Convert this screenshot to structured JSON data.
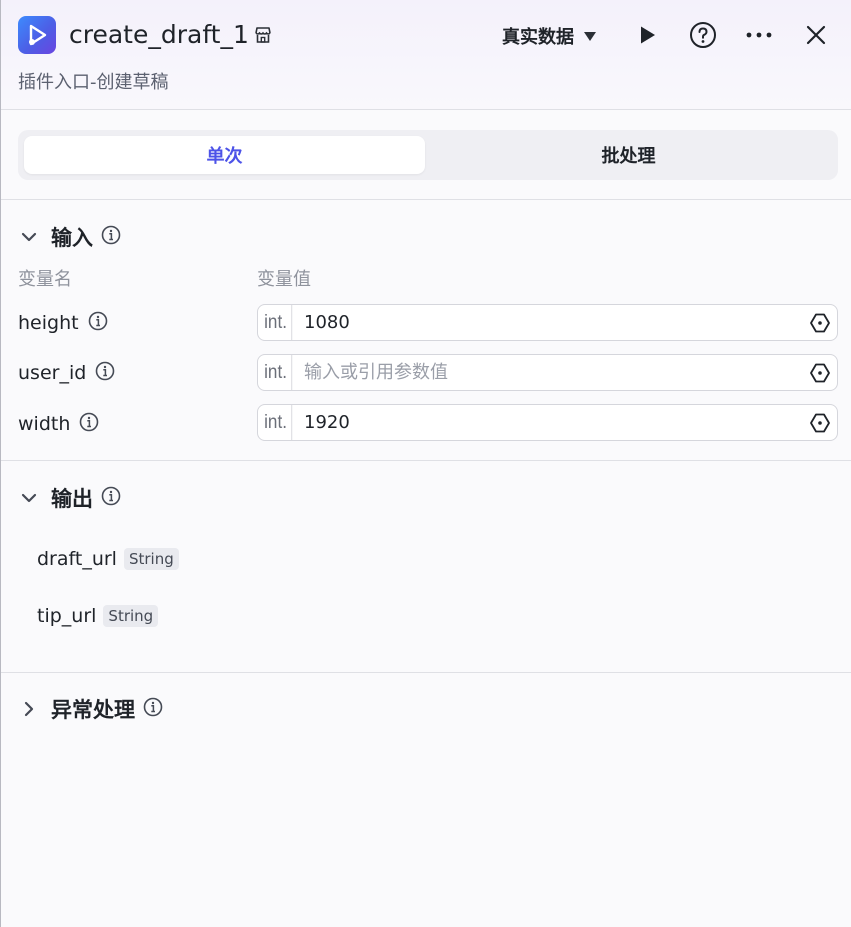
{
  "header": {
    "title": "create_draft_1",
    "subtitle": "插件入口-创建草稿",
    "mode_label": "真实数据",
    "icons": [
      "app-play-icon",
      "store-icon",
      "caret-down-icon",
      "run-icon",
      "help-icon",
      "more-icon",
      "close-icon"
    ]
  },
  "tabs": [
    {
      "label": "单次",
      "active": true
    },
    {
      "label": "批处理",
      "active": false
    }
  ],
  "input_section": {
    "title": "输入",
    "col_name": "变量名",
    "col_value": "变量值",
    "rows": [
      {
        "name": "height",
        "type": "int.",
        "value": "1080",
        "placeholder": ""
      },
      {
        "name": "user_id",
        "type": "int.",
        "value": "",
        "placeholder": "输入或引用参数值"
      },
      {
        "name": "width",
        "type": "int.",
        "value": "1920",
        "placeholder": ""
      }
    ]
  },
  "output_section": {
    "title": "输出",
    "rows": [
      {
        "name": "draft_url",
        "type": "String"
      },
      {
        "name": "tip_url",
        "type": "String"
      }
    ]
  },
  "error_section": {
    "title": "异常处理"
  },
  "colors": {
    "accent": "#4d53e8",
    "text": "#1f2329",
    "muted": "#8f939d"
  }
}
